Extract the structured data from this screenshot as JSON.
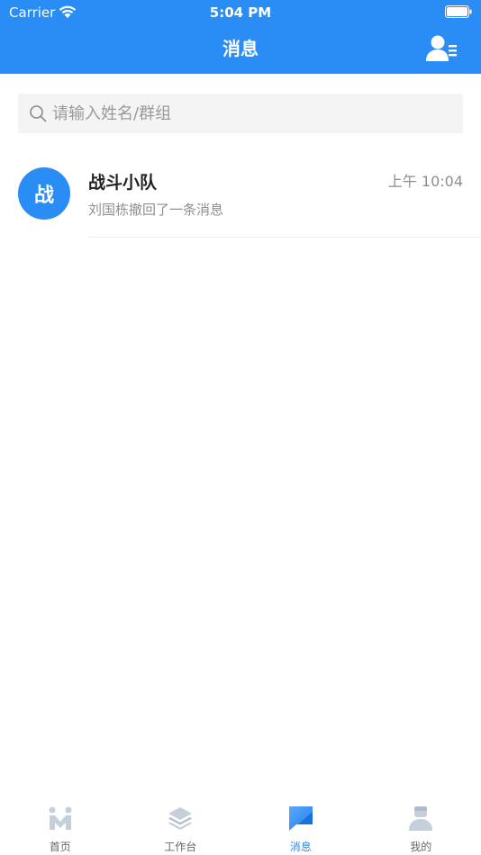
{
  "status_bar": {
    "carrier": "Carrier",
    "time": "5:04 PM"
  },
  "header": {
    "title": "消息",
    "right_icon": "contacts-list-icon"
  },
  "search": {
    "placeholder": "请输入姓名/群组",
    "value": ""
  },
  "conversations": [
    {
      "avatar_text": "战",
      "title": "战斗小队",
      "time": "上午 10:04",
      "subtitle": "刘国栋撤回了一条消息"
    }
  ],
  "tabs": [
    {
      "label": "首页",
      "icon": "home-icon",
      "active": false
    },
    {
      "label": "工作台",
      "icon": "workbench-icon",
      "active": false
    },
    {
      "label": "消息",
      "icon": "message-icon",
      "active": true
    },
    {
      "label": "我的",
      "icon": "profile-icon",
      "active": false
    }
  ],
  "colors": {
    "primary": "#2a8cf5",
    "tab_inactive": "#c5cfdc",
    "text_secondary": "#8e8e8e"
  }
}
